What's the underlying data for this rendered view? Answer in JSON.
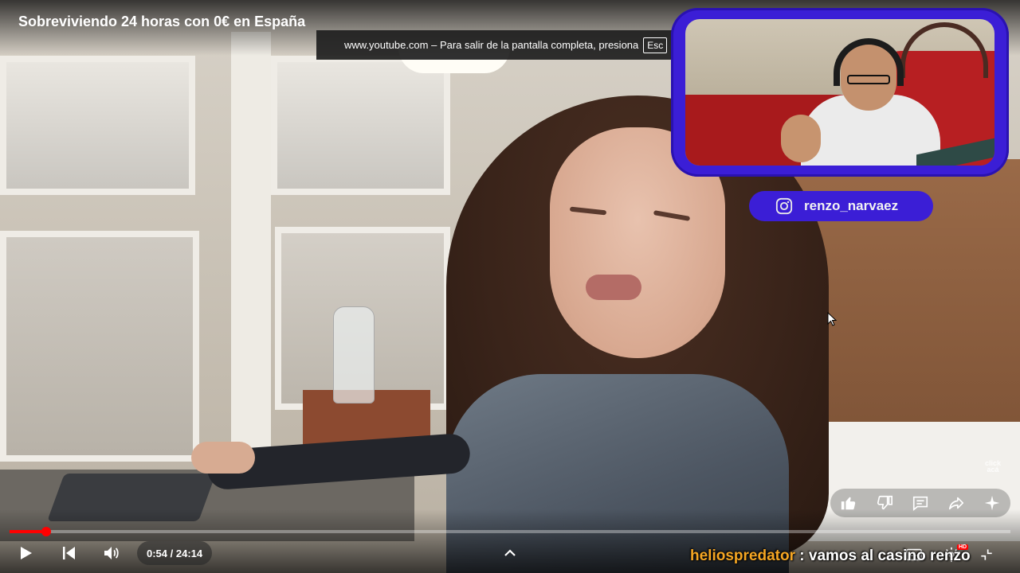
{
  "video": {
    "title": "Sobreviviendo 24 horas con 0€ en España"
  },
  "fullscreen_notice": {
    "text": "www.youtube.com – Para salir de la pantalla completa, presiona",
    "key": "Esc"
  },
  "overlay": {
    "instagram_handle": "renzo_narvaez",
    "watermark": "click acá"
  },
  "actions": {
    "items": [
      {
        "name": "like",
        "icon": "thumbs-up-icon"
      },
      {
        "name": "dislike",
        "icon": "thumbs-down-icon"
      },
      {
        "name": "comments",
        "icon": "comment-icon"
      },
      {
        "name": "share",
        "icon": "share-icon"
      },
      {
        "name": "ask",
        "icon": "sparkle-icon"
      }
    ]
  },
  "player": {
    "current_time": "0:54",
    "duration": "24:14",
    "time_display": "0:54 / 24:14",
    "progress_fraction": 0.037,
    "buffered_fraction": 0.037,
    "hd_badge": "HD",
    "accent_color": "#ff0000"
  },
  "chat": {
    "username": "heliospredator",
    "separator": ":",
    "message": "vamos al casino renzo"
  },
  "colors": {
    "overlay_purple": "#3b1ed6",
    "chat_username": "#f5a623"
  }
}
